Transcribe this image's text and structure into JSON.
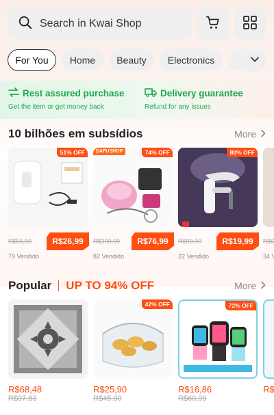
{
  "search": {
    "placeholder": "Search in Kwai Shop"
  },
  "icons": {
    "search": "search-icon",
    "cart": "cart-icon",
    "grid": "grid-icon",
    "chevron": "chevron-down-icon"
  },
  "tabs": [
    {
      "label": "For You",
      "active": true
    },
    {
      "label": "Home",
      "active": false
    },
    {
      "label": "Beauty",
      "active": false
    },
    {
      "label": "Electronics",
      "active": false
    }
  ],
  "guarantee": {
    "left": {
      "title": "Rest assured purchase",
      "subtitle": "Get the item or get money back"
    },
    "right": {
      "title": "Delivery guarantee",
      "subtitle": "Refund for any issues"
    }
  },
  "subsidy": {
    "title": "10 bilhões em subsídios",
    "more": "More",
    "items": [
      {
        "off": "51% OFF",
        "orig": "R$55,00",
        "price": "R$26,99",
        "sold": "79 Vendido",
        "shop": ""
      },
      {
        "off": "74% OFF",
        "orig": "R$300,00",
        "price": "R$76,99",
        "sold": "82 Vendido",
        "shop": "DAFUSHOP"
      },
      {
        "off": "80% OFF",
        "orig": "R$99,00",
        "price": "R$19,99",
        "sold": "22 Vendido",
        "shop": ""
      },
      {
        "off": "",
        "orig": "R$6",
        "price": "",
        "sold": "34 V",
        "shop": ""
      }
    ]
  },
  "popular": {
    "title": "Popular",
    "promo": "UP TO 94% OFF",
    "more": "More",
    "items": [
      {
        "off": "",
        "price": "R$68,48",
        "orig": "R$97,83"
      },
      {
        "off": "42% OFF",
        "price": "R$25,90",
        "orig": "R$45,00"
      },
      {
        "off": "72% OFF",
        "price": "R$16,86",
        "orig": "R$60,99"
      },
      {
        "off": "",
        "price": "R$",
        "orig": ""
      }
    ]
  },
  "colors": {
    "accent": "#ff4e12",
    "green": "#1fa84f",
    "chip_bg": "#efefef"
  }
}
